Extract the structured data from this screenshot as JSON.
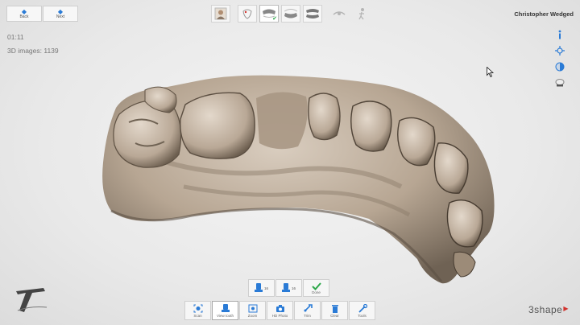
{
  "nav": {
    "back_label": "Back",
    "next_label": "Next"
  },
  "workflow": {
    "steps": [
      {
        "name": "patient",
        "icon": "patient-photo-icon"
      },
      {
        "name": "order",
        "icon": "tooth-order-icon"
      },
      {
        "name": "upper-scan",
        "icon": "upper-jaw-icon",
        "done": true
      },
      {
        "name": "lower-scan",
        "icon": "lower-jaw-icon"
      },
      {
        "name": "bite-scan",
        "icon": "bite-jaw-icon"
      },
      {
        "name": "analyze",
        "icon": "analysis-icon"
      },
      {
        "name": "send",
        "icon": "send-person-icon"
      }
    ]
  },
  "user": {
    "name": "Christopher Wedged"
  },
  "hud": {
    "timer": "01:11",
    "images_label": "3D images: 1139"
  },
  "upper_toolbar": {
    "btn1_num": "16",
    "btn2_num": "16",
    "done_label": "Done"
  },
  "toolbar": {
    "scan": "Scan",
    "view_tooth": "View tooth",
    "zoom": "Zoom",
    "hd_photo": "HD Photo",
    "trim": "Trim",
    "clear": "Clear",
    "tools": "Tools"
  },
  "brand": {
    "name": "3shape"
  },
  "colors": {
    "accent": "#2a7bd6",
    "check": "#2da84a",
    "brand_red": "#d2322d",
    "model": "#b9a896"
  }
}
